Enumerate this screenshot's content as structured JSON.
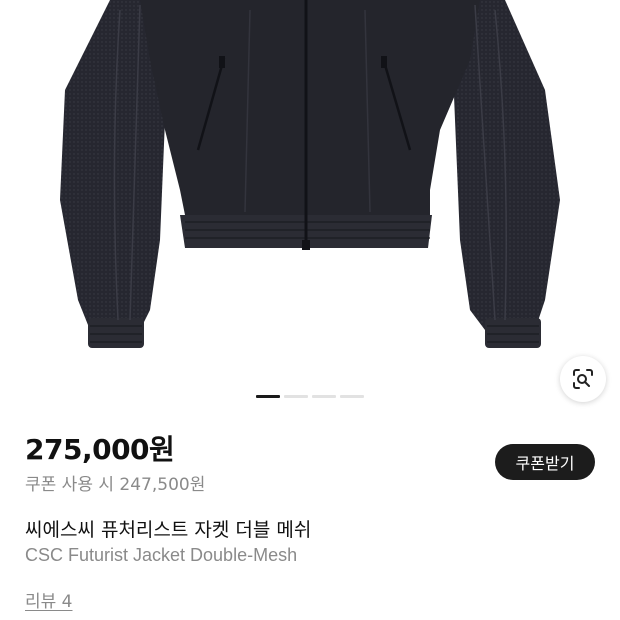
{
  "price": {
    "current": "275,000원",
    "coupon": "쿠폰 사용 시 247,500원"
  },
  "coupon_button": {
    "label": "쿠폰받기"
  },
  "product": {
    "title_ko": "씨에스씨 퓨처리스트 자켓 더블 메쉬",
    "title_en": "CSC Futurist Jacket Double-Mesh"
  },
  "review": {
    "label": "리뷰 4"
  },
  "gallery": {
    "total_images": 4,
    "current_index": 1
  },
  "icons": {
    "lens": "lens-search-icon"
  },
  "colors": {
    "jacket": "#25262d",
    "button": "#1c1c1c",
    "muted_text": "#8a8a8a"
  }
}
